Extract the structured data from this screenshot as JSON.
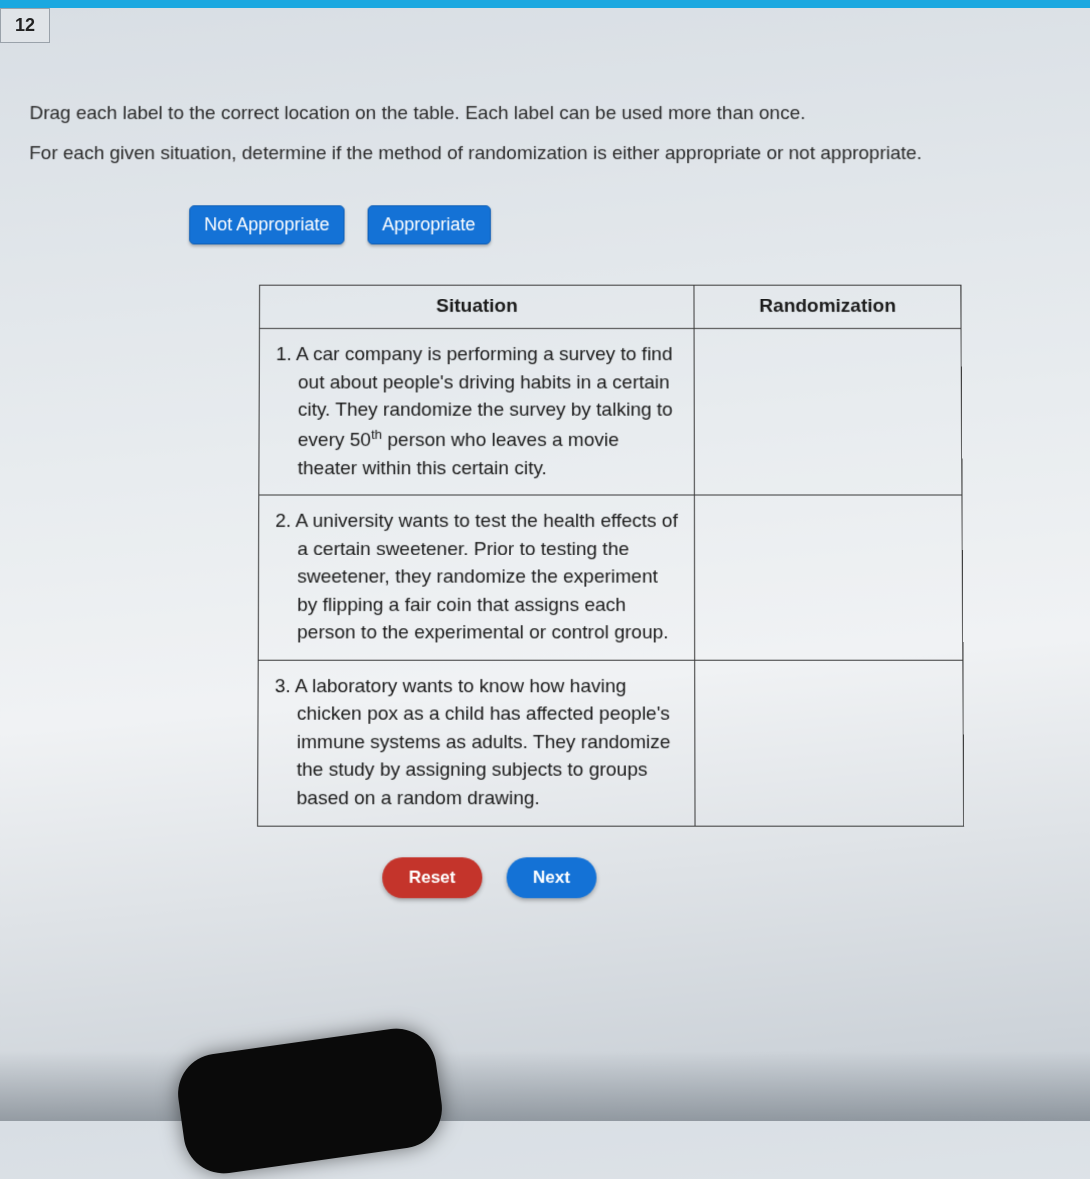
{
  "questionNumber": "12",
  "instruction1": "Drag each label to the correct location on the table. Each label can be used more than once.",
  "instruction2": "For each given situation, determine if the method of randomization is either appropriate or not appropriate.",
  "labels": {
    "notAppropriate": "Not Appropriate",
    "appropriate": "Appropriate"
  },
  "table": {
    "headers": {
      "situation": "Situation",
      "randomization": "Randomization"
    },
    "rows": [
      {
        "num": "1.",
        "textPre": "A car company is performing a survey to find out about people's driving habits in a certain city. They randomize the survey by talking to every 50",
        "sup": "th",
        "textPost": " person who leaves a movie theater within this certain city."
      },
      {
        "num": "2.",
        "textPre": "A university wants to test the health effects of a certain sweetener. Prior to testing the sweetener, they randomize the experiment by flipping a fair coin that assigns each person to the experimental or control group.",
        "sup": "",
        "textPost": ""
      },
      {
        "num": "3.",
        "textPre": "A laboratory wants to know how having chicken pox as a child has affected people's immune systems as adults. They randomize the study by assigning subjects to groups based on a random drawing.",
        "sup": "",
        "textPost": ""
      }
    ]
  },
  "buttons": {
    "reset": "Reset",
    "next": "Next"
  }
}
